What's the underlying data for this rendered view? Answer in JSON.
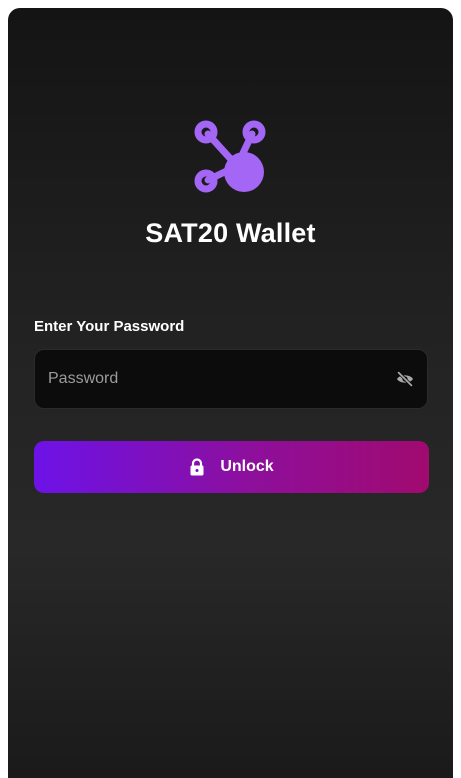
{
  "app": {
    "title": "SAT20 Wallet"
  },
  "login": {
    "label": "Enter Your Password",
    "password_value": "",
    "password_placeholder": "Password",
    "unlock_label": "Unlock"
  },
  "icons": {
    "logo": "sat20-logo-icon",
    "visibility_toggle": "eye-slash-icon",
    "unlock": "lock-icon"
  },
  "colors": {
    "background_top": "#141414",
    "background_mid": "#282828",
    "logo_purple": "#a366f5",
    "field_background": "#0c0c0c",
    "button_gradient_start": "#6d12e8",
    "button_gradient_end": "#a10a6f",
    "text_primary": "#ffffff",
    "text_placeholder": "#9b9b9b"
  }
}
